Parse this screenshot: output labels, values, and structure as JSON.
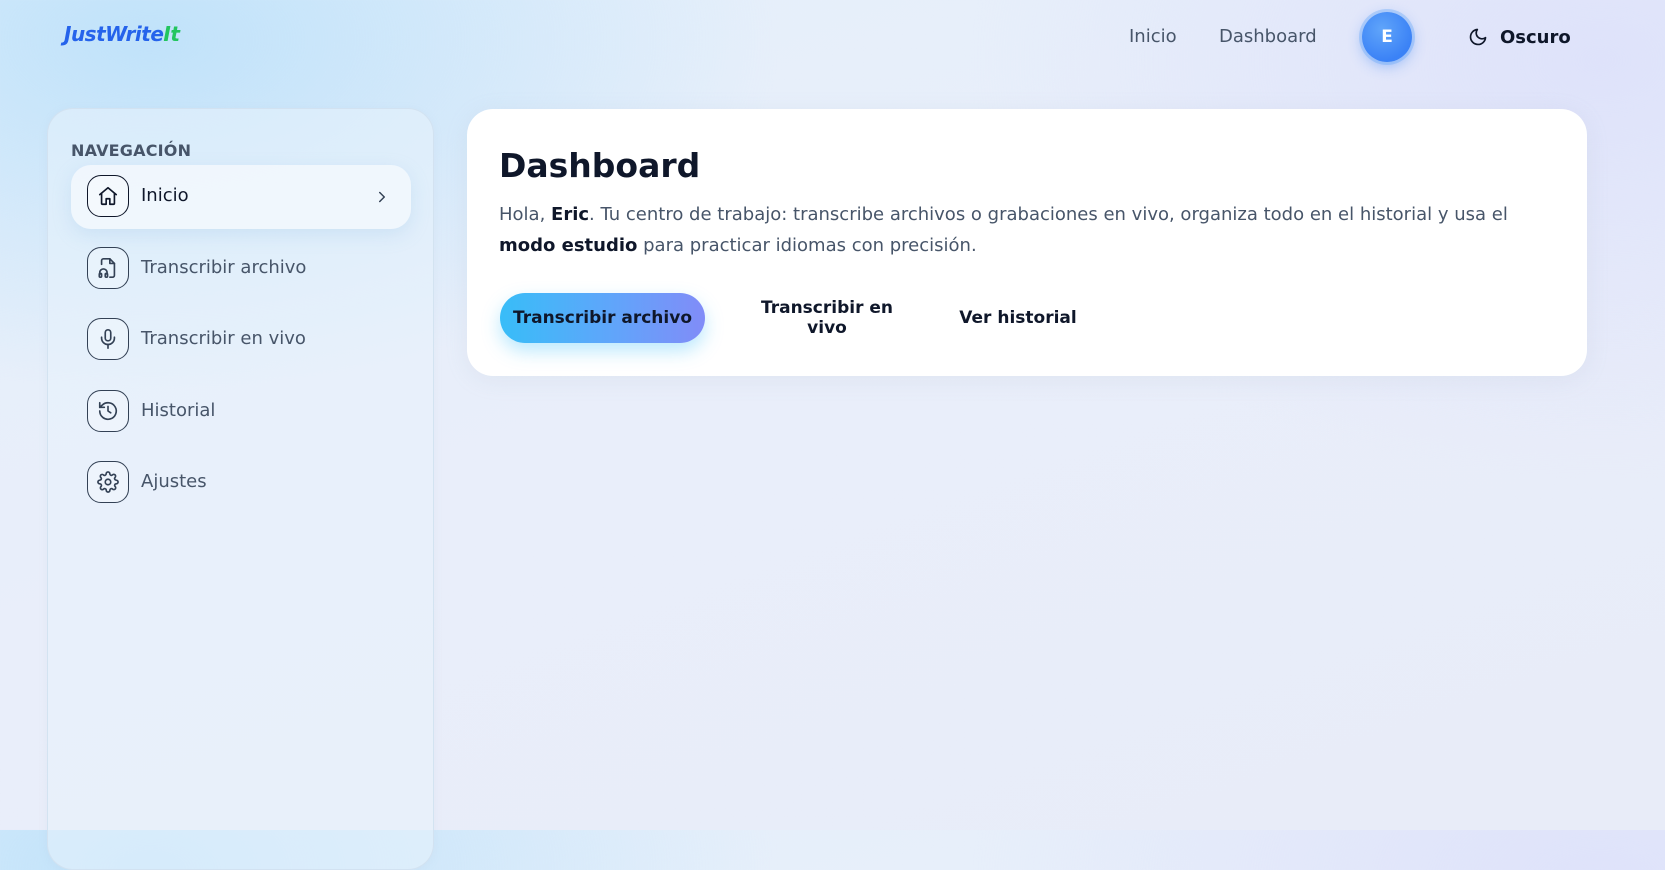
{
  "header": {
    "logo_main": "JustWrite",
    "logo_accent": "It",
    "nav": [
      {
        "label": "Inicio"
      },
      {
        "label": "Dashboard"
      }
    ],
    "avatar_initial": "E",
    "theme_toggle_label": "Oscuro"
  },
  "sidebar": {
    "title": "NAVEGACIÓN",
    "items": [
      {
        "label": "Inicio",
        "icon": "home-icon",
        "active": true
      },
      {
        "label": "Transcribir archivo",
        "icon": "file-audio-icon",
        "active": false
      },
      {
        "label": "Transcribir en vivo",
        "icon": "microphone-icon",
        "active": false
      },
      {
        "label": "Historial",
        "icon": "history-icon",
        "active": false
      },
      {
        "label": "Ajustes",
        "icon": "gear-icon",
        "active": false
      }
    ]
  },
  "main": {
    "title": "Dashboard",
    "greeting": "Hola, ",
    "user_name": "Eric",
    "desc_part1": ". Tu centro de trabajo: transcribe archivos o grabaciones en vivo, organiza todo en el historial y usa el ",
    "desc_bold": "modo estudio",
    "desc_part2": " para practicar idiomas con precisión.",
    "buttons": {
      "primary": "Transcribir archivo",
      "live": "Transcribir en vivo",
      "history": "Ver historial"
    }
  },
  "colors": {
    "brand": "#2563eb",
    "brand_accent": "#22c55e",
    "primary_gradient_start": "#38bdf8",
    "primary_gradient_end": "#818cf8",
    "avatar": "#3b82f6",
    "text_dark": "#0f172a",
    "text_muted": "#475569"
  }
}
